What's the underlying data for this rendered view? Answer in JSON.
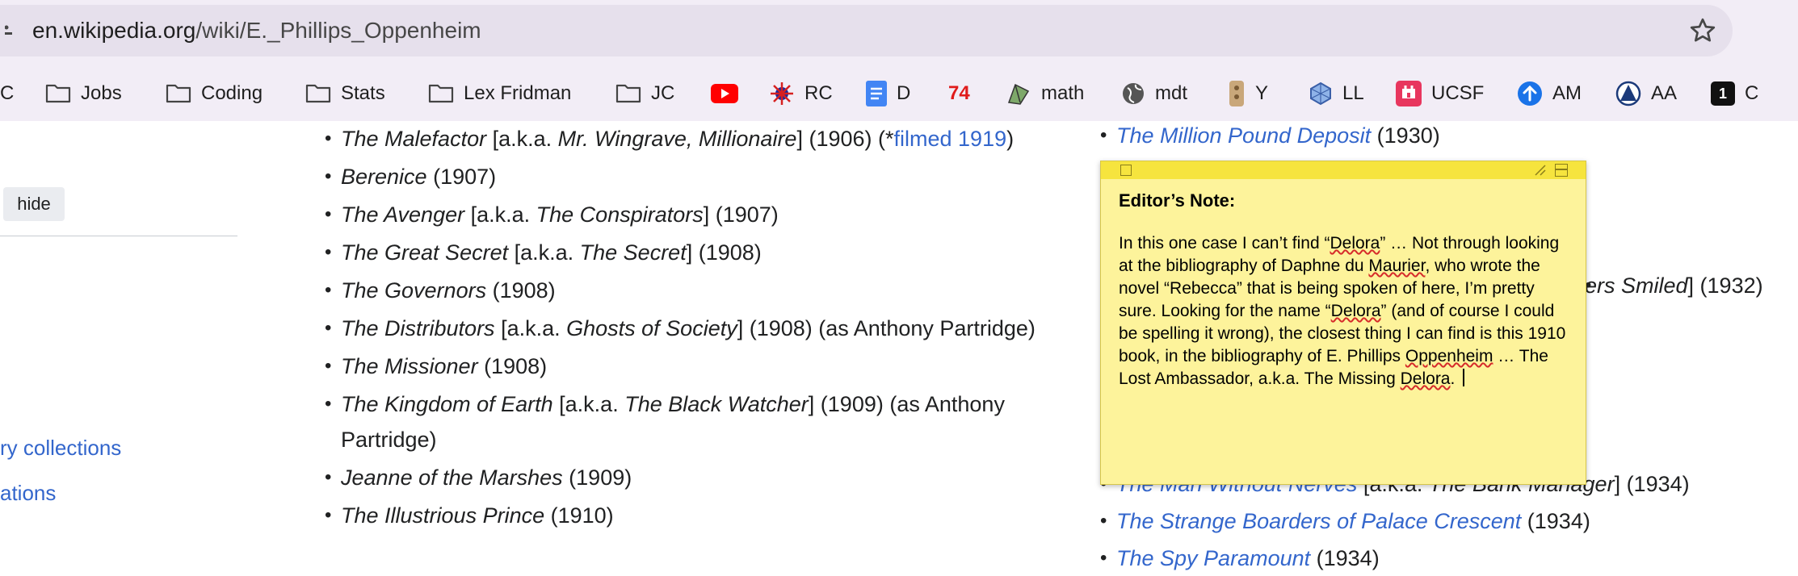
{
  "browser": {
    "url_host": "en.wikipedia.org",
    "url_path": "/wiki/E._Phillips_Oppenheim",
    "bookmarks": [
      {
        "label": "C",
        "icon": "folder-icon"
      },
      {
        "label": "Jobs",
        "icon": "folder-icon"
      },
      {
        "label": "Coding",
        "icon": "folder-icon"
      },
      {
        "label": "Stats",
        "icon": "folder-icon"
      },
      {
        "label": "Lex Fridman",
        "icon": "folder-icon"
      },
      {
        "label": "JC",
        "icon": "folder-icon"
      },
      {
        "label": "",
        "icon": "youtube-icon"
      },
      {
        "label": "RC",
        "icon": "rc-icon"
      },
      {
        "label": "D",
        "icon": "docs-icon"
      },
      {
        "label": "74",
        "icon": "none"
      },
      {
        "label": "math",
        "icon": "math-icon"
      },
      {
        "label": "mdt",
        "icon": "globe-icon"
      },
      {
        "label": "Y",
        "icon": "y-icon"
      },
      {
        "label": "LL",
        "icon": "ll-icon"
      },
      {
        "label": "UCSF",
        "icon": "ucsf-icon"
      },
      {
        "label": "AM",
        "icon": "am-icon"
      },
      {
        "label": "AA",
        "icon": "aa-icon"
      },
      {
        "label": "C",
        "icon": "c-box-icon",
        "badge": "1"
      }
    ]
  },
  "sidebar": {
    "hide_label": "hide",
    "links": [
      "ry collections",
      "ations"
    ]
  },
  "books_col1": [
    {
      "title": "The Malefactor",
      "mid": " [a.k.a. ",
      "alt": "Mr. Wingrave, Millionaire",
      "end": "] (1906) (*",
      "link": "filmed 1919",
      "tail": ")"
    },
    {
      "title": "Berenice",
      "tail": " (1907)"
    },
    {
      "title": "The Avenger",
      "mid": " [a.k.a. ",
      "alt": "The Conspirators",
      "end": "] (1907)"
    },
    {
      "title": "The Great Secret",
      "mid": " [a.k.a. ",
      "alt": "The Secret",
      "end": "] (1908)"
    },
    {
      "title": "The Governors",
      "tail": " (1908)"
    },
    {
      "title": "The Distributors",
      "mid": " [a.k.a. ",
      "alt": "Ghosts of Society",
      "end": "] (1908) (as Anthony Partridge)"
    },
    {
      "title": "The Missioner",
      "tail": " (1908)"
    },
    {
      "title": "The Kingdom of Earth",
      "mid": " [a.k.a. ",
      "alt": "The Black Watcher",
      "end": "] (1909) (as Anthony Partridge)"
    },
    {
      "title": "Jeanne of the Marshes",
      "tail": " (1909)"
    },
    {
      "title": "The Illustrious Prince",
      "tail": " (1910)"
    }
  ],
  "books_col2": {
    "first": {
      "title": "The Million Pound Deposit",
      "tail": " (1930)"
    },
    "partial": {
      "alt_fragment": "ers Smiled",
      "tail": "] (1932)"
    },
    "man_without": {
      "title": "The Man Without Nerves",
      "mid": " [a.k.a. ",
      "alt": "The Bank Manager",
      "end": "] (1934)"
    },
    "strange": {
      "title": "The Strange Boarders of Palace Crescent",
      "tail": " (1934)"
    },
    "spy": {
      "title": "The Spy Paramount",
      "tail": " (1934)"
    }
  },
  "note": {
    "title": "Editor’s Note:",
    "body_1": "In this one case I can’t find “",
    "sp1": "Delora",
    "body_2": "” … Not through looking at the bibliography of Daphne du ",
    "sp2": "Maurier",
    "body_3": ", who wrote the novel “Rebecca” that is being spoken of here, I’m pretty sure. Looking for the name “",
    "sp3": "Delora",
    "body_4": "” (and of course I could be spelling it wrong), the closest thing I can find is this 1910 book, in the bibliography of E. Phillips ",
    "sp4": "Oppenheim",
    "body_5": " … The Lost Ambassador, a.k.a. The Missing ",
    "sp5": "Delora",
    "body_6": ". "
  }
}
